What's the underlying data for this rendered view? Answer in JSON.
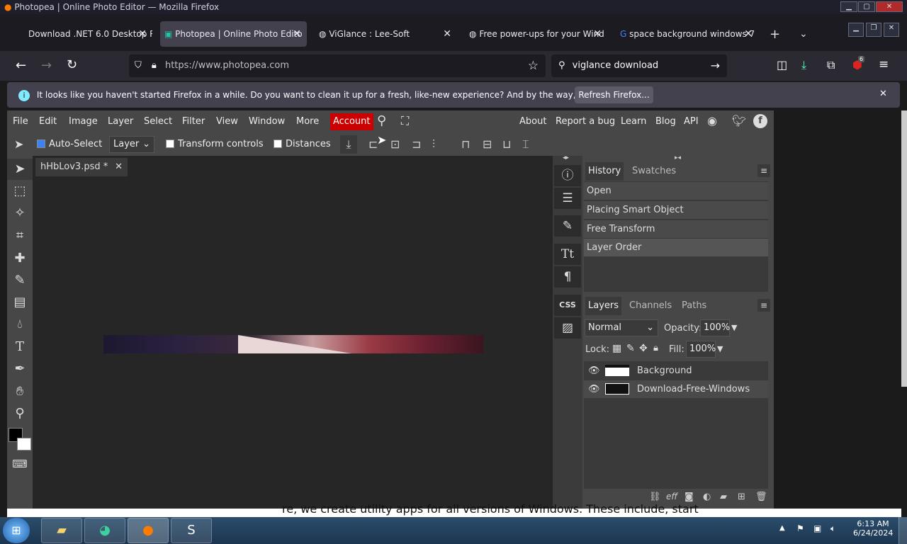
{
  "window": {
    "title": "Photopea | Online Photo Editor — Mozilla Firefox"
  },
  "tabs": [
    {
      "label": "Download .NET 6.0 Desktop R"
    },
    {
      "label": "Photopea | Online Photo Edito"
    },
    {
      "label": "ViGlance : Lee-Soft"
    },
    {
      "label": "Free power-ups for your Wind"
    },
    {
      "label": "space background windows 7"
    }
  ],
  "nav": {
    "url": "https://www.photopea.com",
    "search": "viglance download",
    "badge": "6"
  },
  "notification": {
    "text": "It looks like you haven't started Firefox in a while. Do you want to clean it up for a fresh, like-new experience? And by the way, welcome back!",
    "button": "Refresh Firefox..."
  },
  "menubar": {
    "items": [
      "File",
      "Edit",
      "Image",
      "Layer",
      "Select",
      "Filter",
      "View",
      "Window",
      "More",
      "Account"
    ],
    "right": [
      "About",
      "Report a bug",
      "Learn",
      "Blog",
      "API"
    ]
  },
  "options": {
    "auto_select": "Auto-Select",
    "layer_mode": "Layer",
    "transform": "Transform controls",
    "distances": "Distances"
  },
  "document": {
    "tab": "hHbLov3.psd *"
  },
  "history": {
    "tabs": [
      "History",
      "Swatches"
    ],
    "items": [
      "Open",
      "Placing Smart Object",
      "Free Transform",
      "Layer Order"
    ]
  },
  "layers": {
    "tabs": [
      "Layers",
      "Channels",
      "Paths"
    ],
    "blend": "Normal",
    "opacity_label": "Opacity:",
    "opacity": "100%",
    "lock_label": "Lock:",
    "fill_label": "Fill:",
    "fill": "100%",
    "items": [
      "Background",
      "Download-Free-Windows"
    ]
  },
  "sideicons": {
    "css": "CSS"
  },
  "bottomtext": "re, we create utility apps for all versions of Windows. These include, start",
  "taskbar": {
    "time": "6:13 AM",
    "date": "6/24/2024"
  },
  "colors": {
    "account": "#cc0000",
    "accent": "#3b82f6"
  }
}
